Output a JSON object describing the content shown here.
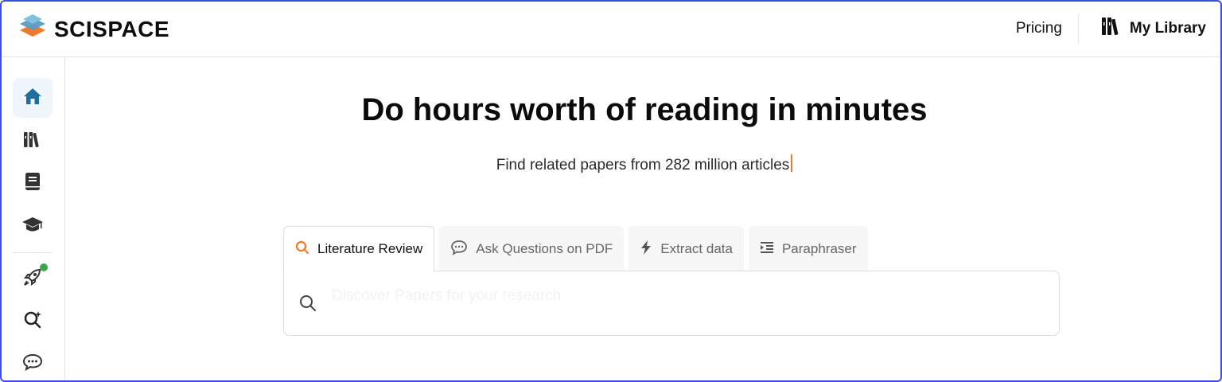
{
  "header": {
    "brand": "SCISPACE",
    "pricing_label": "Pricing",
    "library_label": "My Library"
  },
  "sidebar": {
    "items": [
      {
        "icon": "home-icon",
        "active": true
      },
      {
        "icon": "library-icon",
        "active": false
      },
      {
        "icon": "notebook-icon",
        "active": false
      },
      {
        "icon": "graduation-cap-icon",
        "active": false
      },
      {
        "icon": "rocket-icon",
        "active": false,
        "notification": true
      },
      {
        "icon": "ai-search-icon",
        "active": false
      },
      {
        "icon": "chat-icon",
        "active": false
      }
    ]
  },
  "hero": {
    "title": "Do hours worth of reading in minutes",
    "subtitle": "Find related papers from 282 million articles"
  },
  "tabs": [
    {
      "label": "Literature Review",
      "icon": "search-icon",
      "active": true
    },
    {
      "label": "Ask Questions on PDF",
      "icon": "chat-bubble-icon",
      "active": false
    },
    {
      "label": "Extract data",
      "icon": "lightning-icon",
      "active": false
    },
    {
      "label": "Paraphraser",
      "icon": "indent-icon",
      "active": false
    }
  ],
  "search": {
    "placeholder": "Discover Papers for your research",
    "value": ""
  },
  "colors": {
    "accent_orange": "#f07a2a",
    "active_blue": "#1f6f9e",
    "notification_green": "#3aa84a",
    "frame_border": "#3b4ce0"
  }
}
